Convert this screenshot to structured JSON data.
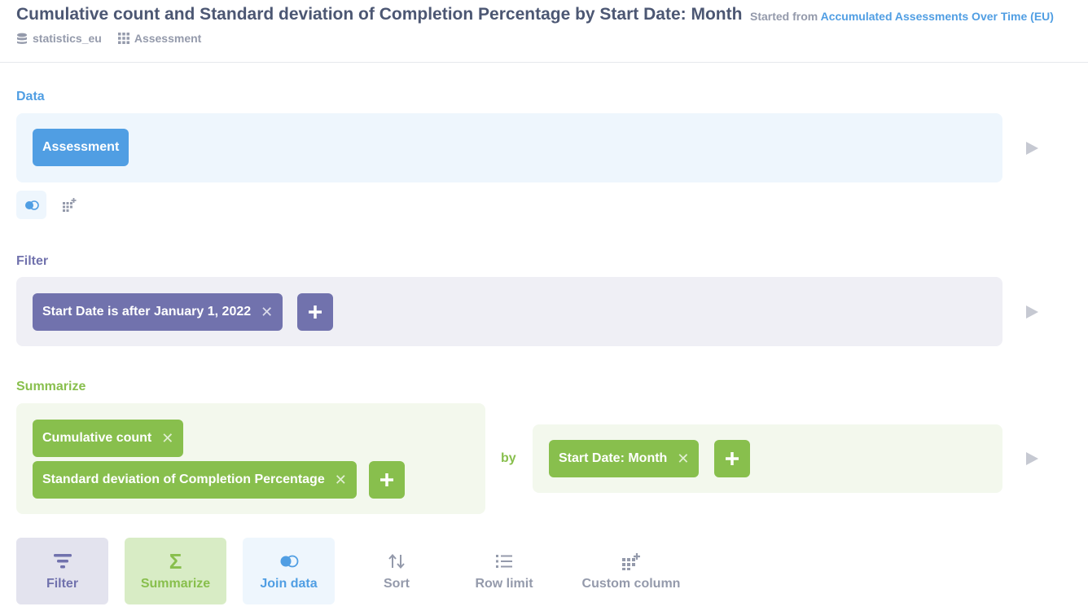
{
  "header": {
    "title": "Cumulative count and Standard deviation of Completion Percentage by Start Date: Month",
    "started_prefix": "Started from",
    "started_link": "Accumulated Assessments Over Time (EU)",
    "breadcrumbs": [
      "statistics_eu",
      "Assessment"
    ]
  },
  "data_section": {
    "label": "Data",
    "table": "Assessment"
  },
  "filter_section": {
    "label": "Filter",
    "filters": [
      "Start Date is after January 1, 2022"
    ]
  },
  "summarize_section": {
    "label": "Summarize",
    "metrics": [
      "Cumulative count",
      "Standard deviation of Completion Percentage"
    ],
    "by_label": "by",
    "breakouts": [
      "Start Date: Month"
    ]
  },
  "actions": {
    "filter": "Filter",
    "summarize": "Summarize",
    "join": "Join data",
    "sort": "Sort",
    "row_limit": "Row limit",
    "custom_column": "Custom column"
  },
  "colors": {
    "data": "#509ee3",
    "filter": "#7172ad",
    "summarize": "#88bf4d",
    "text": "#4c5773",
    "muted": "#949aab"
  }
}
